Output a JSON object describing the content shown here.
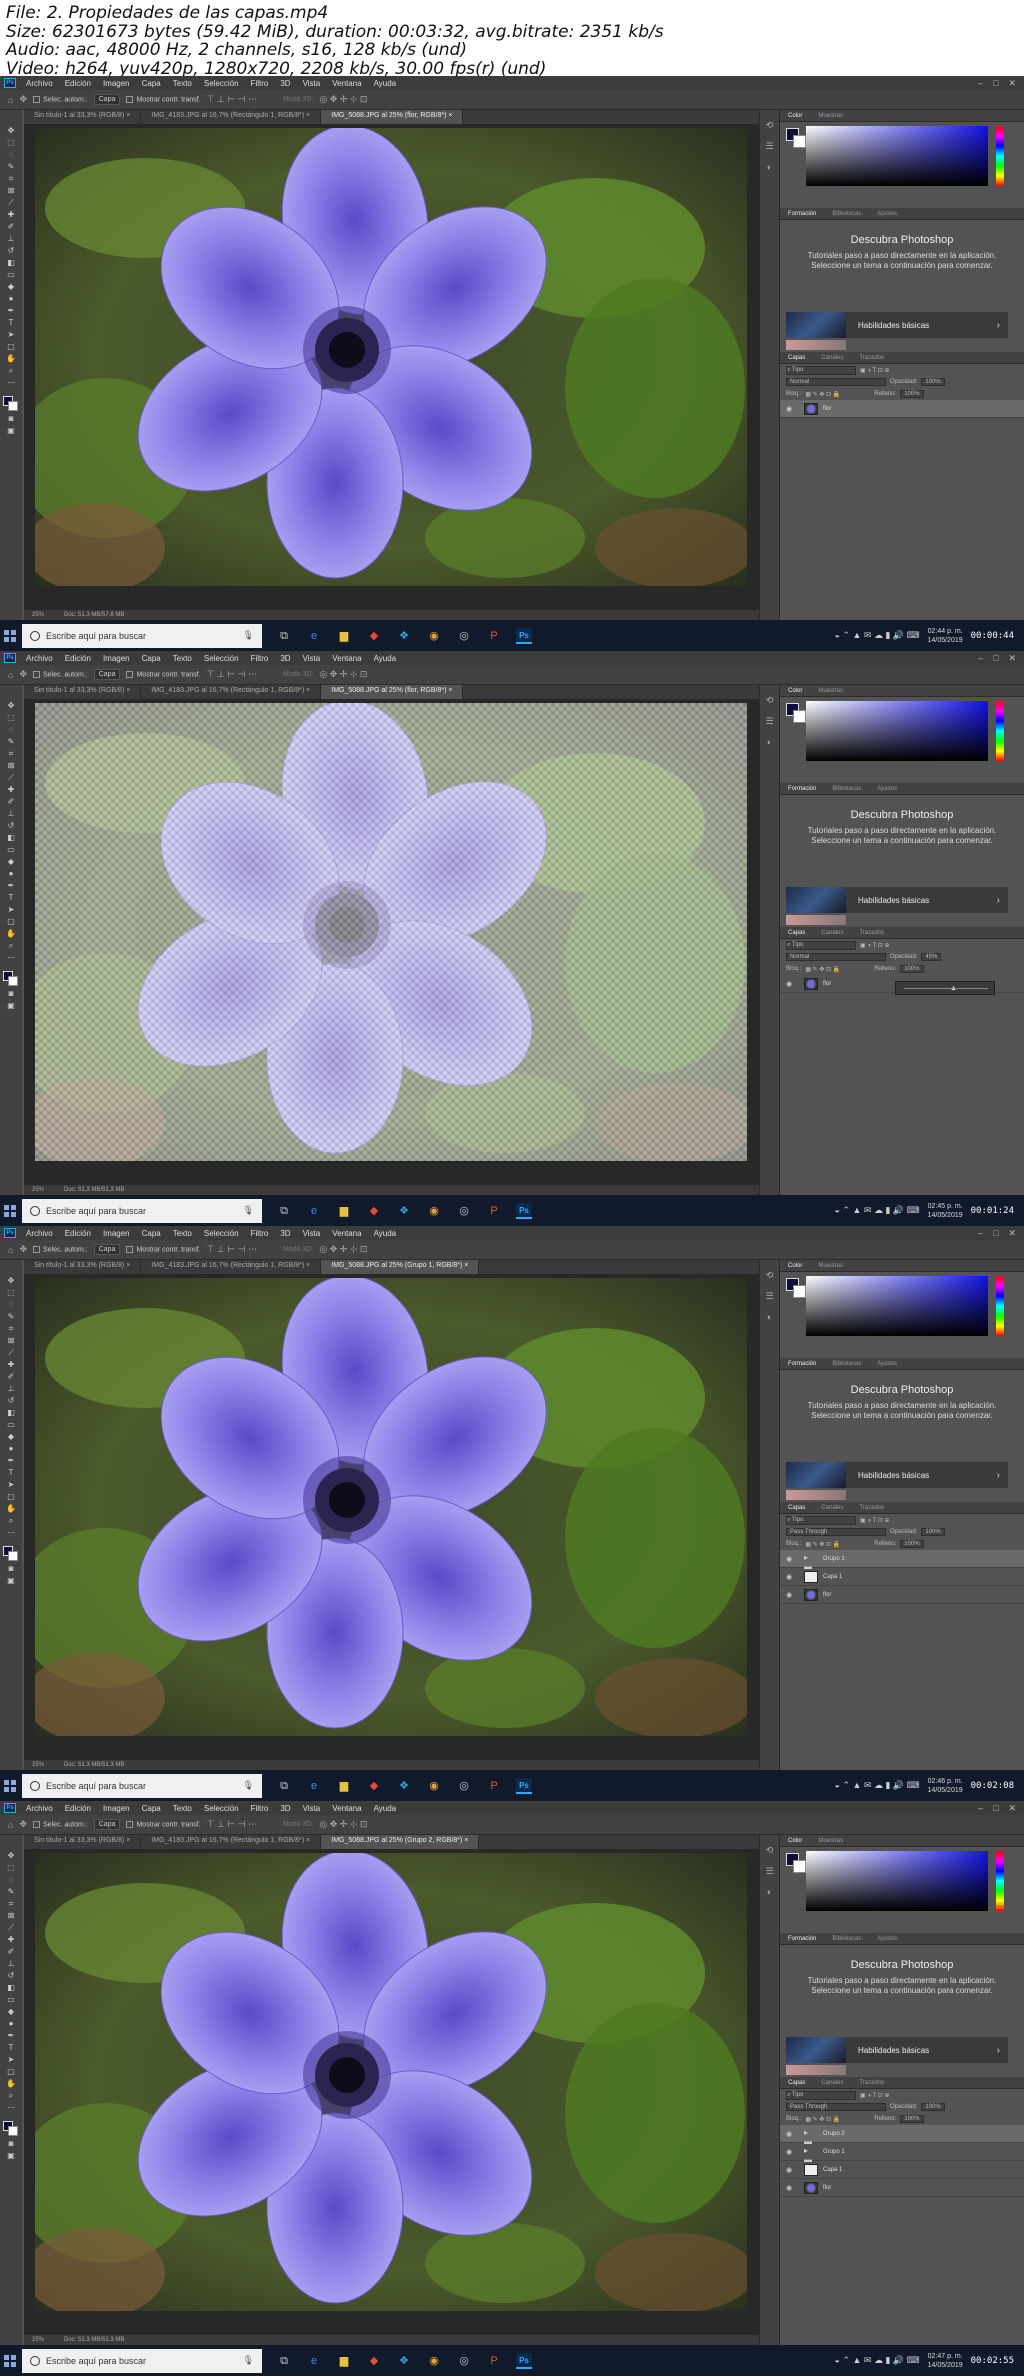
{
  "video_info": {
    "file": "File: 2. Propiedades de las capas.mp4",
    "size": "Size: 62301673 bytes (59.42 MiB), duration: 00:03:32, avg.bitrate: 2351 kb/s",
    "audio": "Audio: aac, 48000 Hz, 2 channels, s16, 128 kb/s (und)",
    "video": "Video: h264, yuv420p, 1280x720, 2208 kb/s, 30.00 fps(r) (und)"
  },
  "menu": [
    "Archivo",
    "Edición",
    "Imagen",
    "Capa",
    "Texto",
    "Selección",
    "Filtro",
    "3D",
    "Vista",
    "Ventana",
    "Ayuda"
  ],
  "options": {
    "auto_select": "Selec. autom.:",
    "layer_dropdown": "Capa",
    "show_transform": "Mostrar contr. transf.",
    "mode_3d": "Modo 3D:"
  },
  "tabs": {
    "untitled": "Sin título-1 al 33,3% (RGB/8) ×",
    "img4183": "IMG_4183.JPG al 16,7% (Rectángulo 1, RGB/8*) ×"
  },
  "panels": {
    "color_tab": "Color",
    "swatches_tab": "Muestras",
    "learn_tab": "Formación",
    "libraries_tab": "Bibliotecas",
    "adjust_tab": "Ajustes",
    "learn_title": "Descubra Photoshop",
    "learn_desc": "Tutoriales paso a paso directamente en la aplicación. Seleccione un tema a continuación para comenzar.",
    "card_label": "Habilidades básicas",
    "layers_tab": "Capas",
    "channels_tab": "Canales",
    "paths_tab": "Trazados",
    "kind": "Tipo",
    "opacity_label": "Opacidad:",
    "lock_label": "Bloq.:",
    "fill_label": "Relleno:",
    "fill_value": "100%"
  },
  "taskbar": {
    "search_placeholder": "Escribe aquí para buscar",
    "date": "14/05/2019"
  },
  "frames": [
    {
      "active_tab": "IMG_5088.JPG al 25% (flor, RGB/8*) ×",
      "status_zoom": "25%",
      "status_doc": "Doc: 51,3 MB/57,8 MB",
      "blend_mode": "Normal",
      "opacity_value": "100%",
      "time": "02:44 p. m.",
      "stamp": "00:00:44",
      "layers": [
        {
          "name": "flor",
          "thumb": "flower",
          "active": true
        }
      ]
    },
    {
      "active_tab": "IMG_5088.JPG al 25% (flor, RGB/8*) ×",
      "status_zoom": "25%",
      "status_doc": "Doc: 51,3 MB/51,3 MB",
      "blend_mode": "Normal",
      "opacity_value": "45%",
      "time": "02:45 p. m.",
      "stamp": "00:01:24",
      "layers": [
        {
          "name": "flor",
          "thumb": "flower",
          "active": false
        }
      ]
    },
    {
      "active_tab": "IMG_5088.JPG al 25% (Grupo 1, RGB/8*) ×",
      "status_zoom": "25%",
      "status_doc": "Doc: 51,3 MB/51,3 MB",
      "blend_mode": "Pass Through",
      "opacity_value": "100%",
      "time": "02:46 p. m.",
      "stamp": "00:02:08",
      "layers": [
        {
          "name": "Grupo 1",
          "thumb": "folder",
          "active": true
        },
        {
          "name": "Capa 1",
          "thumb": "blank",
          "active": false
        },
        {
          "name": "flor",
          "thumb": "flower",
          "active": false
        }
      ]
    },
    {
      "active_tab": "IMG_5088.JPG al 25% (Grupo 2, RGB/8*) ×",
      "status_zoom": "25%",
      "status_doc": "Doc: 51,3 MB/51,3 MB",
      "blend_mode": "Pass Through",
      "opacity_value": "100%",
      "time": "02:47 p. m.",
      "stamp": "00:02:55",
      "layers": [
        {
          "name": "Grupo 2",
          "thumb": "folder",
          "active": true
        },
        {
          "name": "Grupo 1",
          "thumb": "folder",
          "active": false
        },
        {
          "name": "Capa 1",
          "thumb": "blank",
          "active": false
        },
        {
          "name": "flor",
          "thumb": "flower",
          "active": false
        }
      ]
    }
  ]
}
